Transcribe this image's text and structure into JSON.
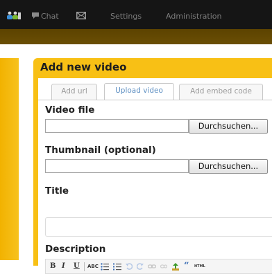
{
  "nav": {
    "chat_label": "Chat",
    "settings_label": "Settings",
    "administration_label": "Administration"
  },
  "panel": {
    "title": "Add new video"
  },
  "tabs": [
    {
      "label": "Add url",
      "active": false
    },
    {
      "label": "Upload video",
      "active": true
    },
    {
      "label": "Add embed code",
      "active": false
    }
  ],
  "form": {
    "video_file_label": "Video file",
    "video_file_value": "",
    "browse_label": "Durchsuchen...",
    "thumbnail_label": "Thumbnail (optional)",
    "thumbnail_value": "",
    "title_label": "Title",
    "title_value": "",
    "description_label": "Description"
  },
  "editor_toolbar": {
    "bold": "B",
    "italic": "I",
    "underline": "U",
    "spellcheck": "ABC",
    "quote": "“",
    "html": "HTML"
  },
  "icons": {
    "people": "people-icon",
    "chat": "chat-bubble-icon",
    "mail": "mail-icon"
  },
  "colors": {
    "topbar": "#151515",
    "subbar": "#5c4300",
    "panel": "#f8c015",
    "active_tab_text": "#5d8fc2"
  }
}
